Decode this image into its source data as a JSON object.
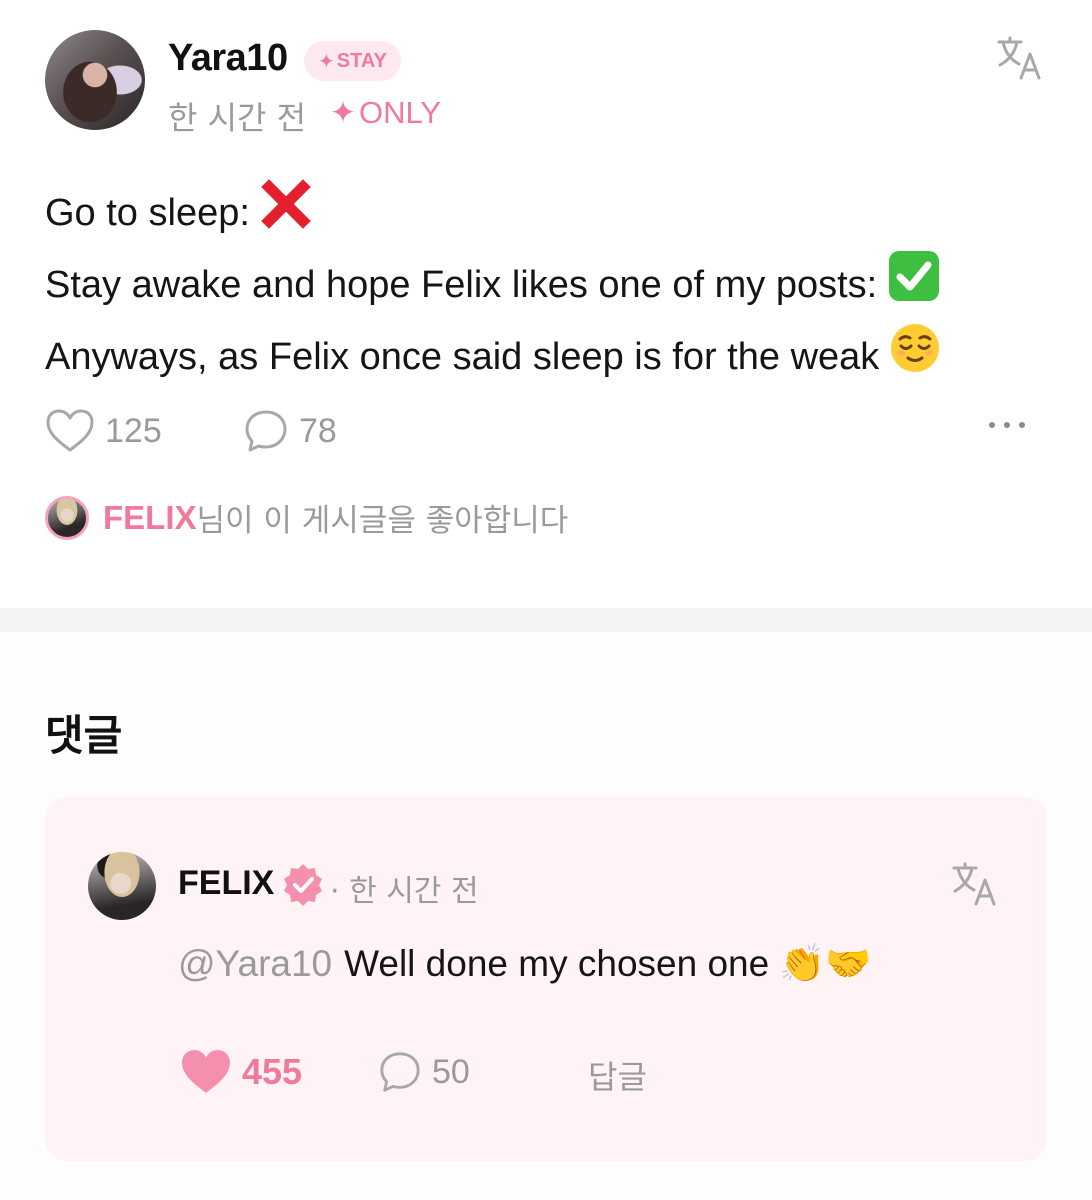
{
  "post": {
    "author": "Yara10",
    "badge": "STAY",
    "time": "한 시간 전",
    "only_label": "ONLY",
    "lines": [
      "Go to sleep:",
      "Stay awake and hope Felix likes one of my posts:",
      "Anyways, as Felix once said sleep is for the weak"
    ],
    "line_emojis": [
      "❌",
      "✅",
      "😌"
    ],
    "like_count": "125",
    "comment_count": "78",
    "liked_by_name": "FELIX",
    "liked_by_text": "님이 이 게시글을 좋아합니다"
  },
  "comments_heading": "댓글",
  "comment": {
    "author": "FELIX",
    "time": "· 한 시간 전",
    "mention": "@Yara10",
    "text": "Well done my chosen one",
    "emojis": "👏🤝",
    "like_count": "455",
    "reply_count": "50",
    "reply_label": "답글"
  },
  "colors": {
    "accent_pink": "#f07a9b",
    "card_bg": "#fff3f6",
    "muted_text": "#9a9a9a"
  },
  "icons": [
    "translate-icon",
    "heart-icon",
    "comment-bubble-icon",
    "more-icon",
    "verified-badge-icon",
    "sparkle-icon"
  ]
}
